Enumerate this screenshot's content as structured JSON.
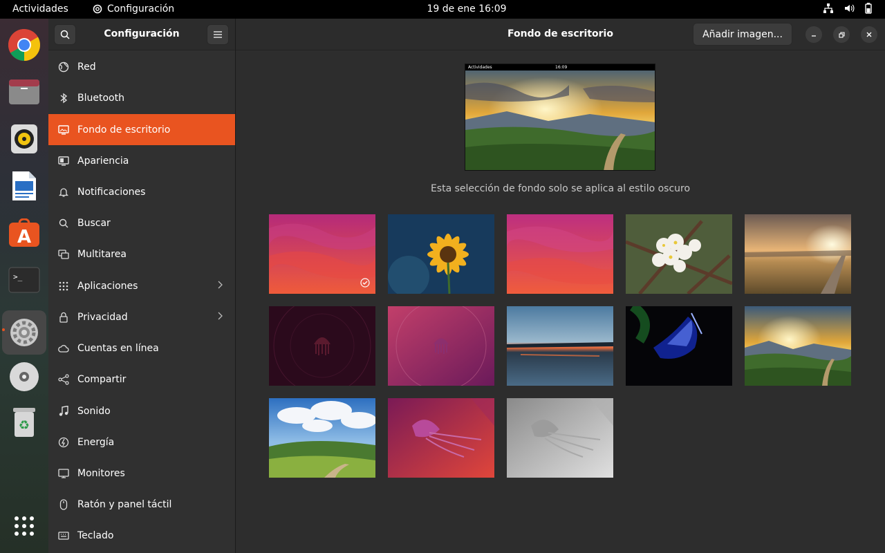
{
  "topbar": {
    "activities": "Actividades",
    "app_name": "Configuración",
    "clock": "19 de ene  16:09"
  },
  "sidebar": {
    "title": "Configuración",
    "items": [
      {
        "label": "Red",
        "icon": "globe-icon"
      },
      {
        "label": "Bluetooth",
        "icon": "bluetooth-icon"
      },
      {
        "label": "Fondo de escritorio",
        "icon": "monitor-icon",
        "active": true
      },
      {
        "label": "Apariencia",
        "icon": "appearance-icon"
      },
      {
        "label": "Notificaciones",
        "icon": "bell-icon"
      },
      {
        "label": "Buscar",
        "icon": "search-icon"
      },
      {
        "label": "Multitarea",
        "icon": "multitask-icon"
      },
      {
        "label": "Aplicaciones",
        "icon": "grid-icon",
        "chevron": true
      },
      {
        "label": "Privacidad",
        "icon": "lock-icon",
        "chevron": true
      },
      {
        "label": "Cuentas en línea",
        "icon": "cloud-icon"
      },
      {
        "label": "Compartir",
        "icon": "share-icon"
      },
      {
        "label": "Sonido",
        "icon": "music-note-icon"
      },
      {
        "label": "Energía",
        "icon": "power-icon"
      },
      {
        "label": "Monitores",
        "icon": "display-icon"
      },
      {
        "label": "Ratón y panel táctil",
        "icon": "mouse-icon"
      },
      {
        "label": "Teclado",
        "icon": "keyboard-icon"
      }
    ]
  },
  "main": {
    "title": "Fondo de escritorio",
    "add_button": "Añadir imagen...",
    "notice": "Esta selección de fondo solo se aplica al estilo oscuro",
    "preview": {
      "activities": "Actividades",
      "clock": "16:09"
    }
  },
  "colors": {
    "accent": "#e95420"
  }
}
